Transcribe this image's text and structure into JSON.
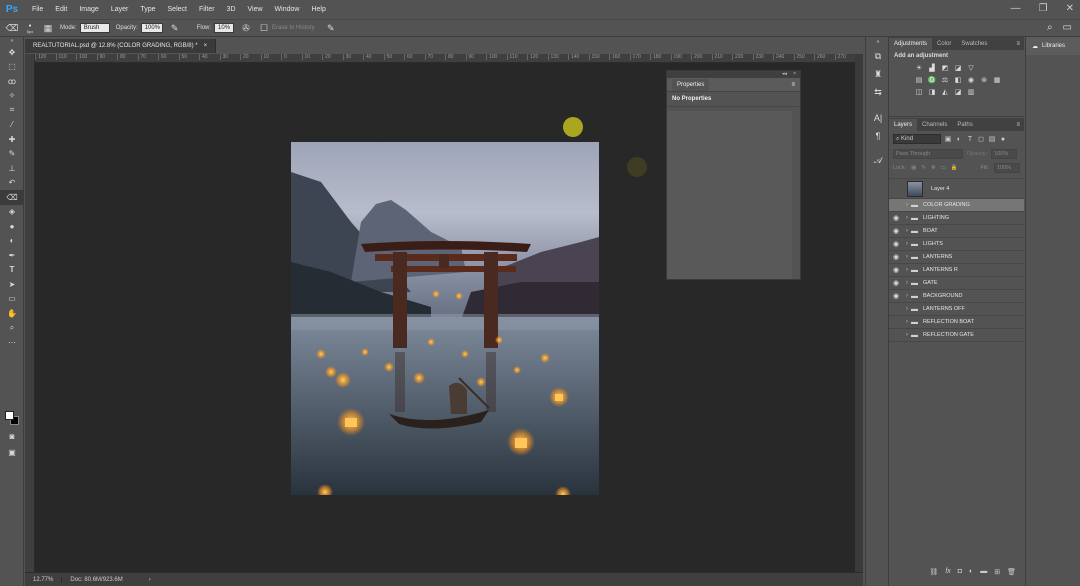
{
  "app": {
    "logo_text": "Ps",
    "menu": [
      "File",
      "Edit",
      "Image",
      "Layer",
      "Type",
      "Select",
      "Filter",
      "3D",
      "View",
      "Window",
      "Help"
    ],
    "window_controls": [
      "—",
      "❐",
      "✕"
    ]
  },
  "options_bar": {
    "brush_size": "5px",
    "mode_label": "Mode:",
    "mode_value": "Brush",
    "opacity_label": "Opacity:",
    "opacity_value": "100%",
    "flow_label": "Flow:",
    "flow_value": "10%",
    "erase_history": "Erase to History"
  },
  "document": {
    "tab_title": "REALTUTORIAL.psd @ 12.8% (COLOR GRADING, RGB/8) *",
    "ruler_ticks": [
      "120",
      "110",
      "100",
      "90",
      "80",
      "70",
      "60",
      "50",
      "40",
      "30",
      "20",
      "10",
      "0",
      "10",
      "20",
      "30",
      "40",
      "50",
      "60",
      "70",
      "80",
      "90",
      "100",
      "110",
      "120",
      "130",
      "140",
      "150",
      "160",
      "170",
      "180",
      "190",
      "200",
      "210",
      "220",
      "230",
      "240",
      "250",
      "260",
      "270"
    ],
    "zoom": "12.77%",
    "doc_size": "Doc: 80.6M/923.6M"
  },
  "properties_panel": {
    "tab": "Properties",
    "header": "No Properties"
  },
  "adjustments_panel": {
    "tabs": [
      "Adjustments",
      "Color",
      "Swatches"
    ],
    "title": "Add an adjustment"
  },
  "layers_panel": {
    "tabs": [
      "Layers",
      "Channels",
      "Paths"
    ],
    "kind": "Kind",
    "blend_mode": "Pass Through",
    "opacity_label": "Opacity:",
    "opacity_value": "100%",
    "lock_label": "Lock:",
    "fill_label": "Fill:",
    "fill_value": "100%",
    "layers": [
      {
        "name": "Layer 4",
        "visible": false,
        "type": "pixel"
      },
      {
        "name": "COLOR GRADING",
        "visible": false,
        "type": "group",
        "selected": true
      },
      {
        "name": "LIGHTING",
        "visible": true,
        "type": "group"
      },
      {
        "name": "BOAT",
        "visible": true,
        "type": "group"
      },
      {
        "name": "LIGHTS",
        "visible": true,
        "type": "group"
      },
      {
        "name": "LANTERNS",
        "visible": true,
        "type": "group"
      },
      {
        "name": "LANTERNS R",
        "visible": true,
        "type": "group"
      },
      {
        "name": "GATE",
        "visible": true,
        "type": "group"
      },
      {
        "name": "BACKGROUND",
        "visible": true,
        "type": "group"
      },
      {
        "name": "LANTERNS OFF",
        "visible": false,
        "type": "group"
      },
      {
        "name": "REFLECTION BOAT",
        "visible": false,
        "type": "group"
      },
      {
        "name": "REFLECTION GATE",
        "visible": false,
        "type": "group"
      }
    ]
  },
  "libraries_panel": {
    "label": "Libraries"
  }
}
